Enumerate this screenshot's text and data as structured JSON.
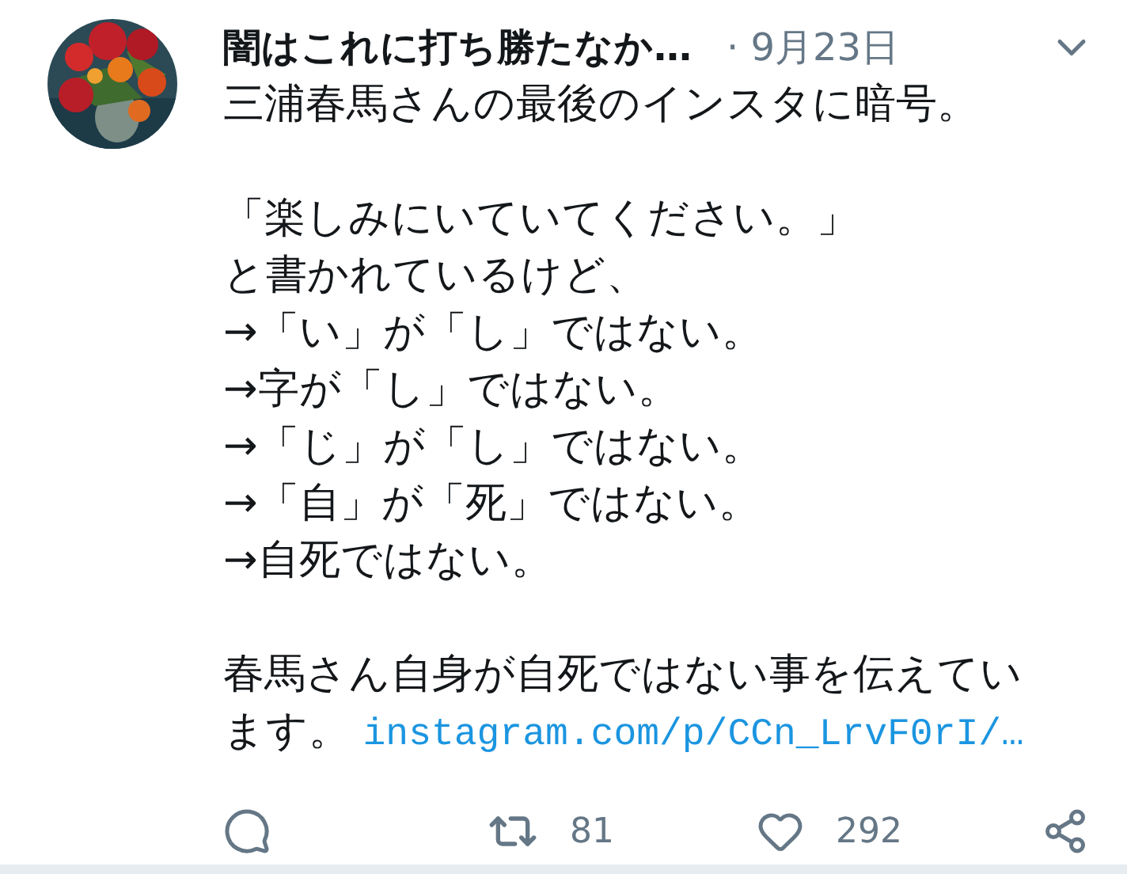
{
  "tweet": {
    "author": "闇はこれに打ち勝たなか…",
    "date": "· 9月23日",
    "paragraphs": [
      [
        "三浦春馬さんの最後のインスタに暗号。"
      ],
      [
        "「楽しみにいていてください。」",
        "と書かれているけど、",
        "→「い」が「し」ではない。",
        "→字が「し」ではない。",
        "→「じ」が「し」ではない。",
        "→「自」が「死」ではない。",
        "→自死ではない。"
      ],
      [
        "春馬さん自身が自死ではない事を伝えています。 "
      ]
    ],
    "link": "instagram.com/p/CCn_LrvF0rI/…"
  },
  "actions": [
    {
      "kind": "reply"
    },
    {
      "kind": "retweet",
      "count": "81"
    },
    {
      "kind": "like",
      "count": "292"
    },
    {
      "kind": "share"
    }
  ]
}
